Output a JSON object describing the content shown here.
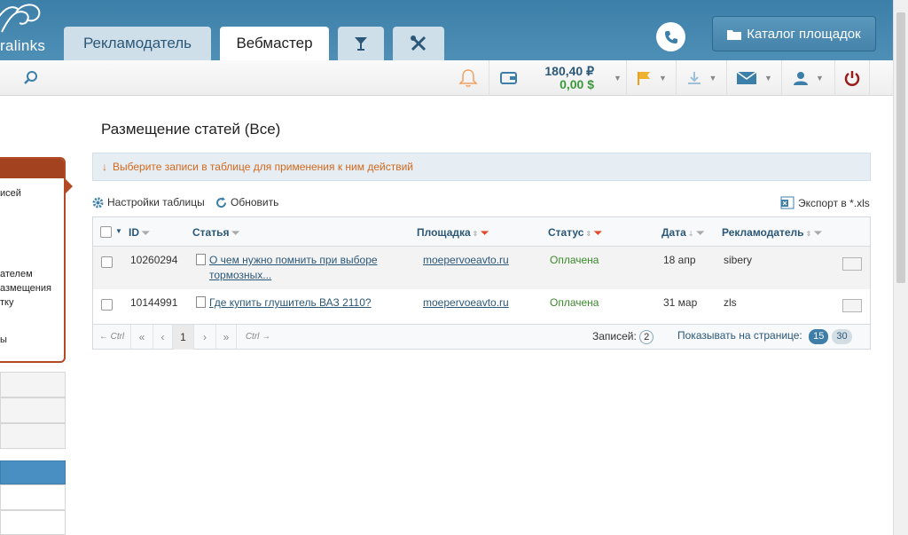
{
  "header": {
    "logo_text": "ralinks",
    "tabs": [
      {
        "label": "Рекламодатель",
        "active": false
      },
      {
        "label": "Вебмастер",
        "active": true
      }
    ],
    "catalog_button": "Каталог площадок"
  },
  "toolbar": {
    "balance_rub": "180,40 ₽",
    "balance_usd": "0,00 $"
  },
  "sidebar": {
    "texts": [
      "исей",
      "ателем",
      "азмещения",
      "тку",
      "ы"
    ]
  },
  "page": {
    "title": "Размещение статей (Все)",
    "notice": "Выберите записи в таблице для применения к ним действий",
    "table_settings": "Настройки таблицы",
    "refresh": "Обновить",
    "export": "Экспорт в *.xls"
  },
  "table": {
    "columns": [
      "ID",
      "Статья",
      "Площадка",
      "Статус",
      "Дата",
      "Рекламодатель"
    ],
    "rows": [
      {
        "id": "10260294",
        "article_l1": "О чем нужно помнить при выборе",
        "article_l2": "тормозных...",
        "site": "moepervoeavto.ru",
        "status": "Оплачена",
        "date": "18 апр",
        "advertiser": "sibery"
      },
      {
        "id": "10144991",
        "article_l1": "Где купить глушитель ВАЗ 2110?",
        "article_l2": "",
        "site": "moepervoeavto.ru",
        "status": "Оплачена",
        "date": "31 мар",
        "advertiser": "zls"
      }
    ]
  },
  "pager": {
    "prev_ctrl": "← Ctrl",
    "first": "«",
    "prev": "‹",
    "page": "1",
    "next": "›",
    "last": "»",
    "next_ctrl": "Ctrl →",
    "records_label": "Записей:",
    "records_count": "2",
    "per_page_label": "Показывать на странице:",
    "per_page_options": [
      "15",
      "30"
    ],
    "per_page_selected": "15"
  },
  "colors": {
    "header_blue": "#4683aa",
    "accent_orange": "#b14a25",
    "status_green": "#3a8a2a",
    "link_blue": "#2b5878"
  }
}
